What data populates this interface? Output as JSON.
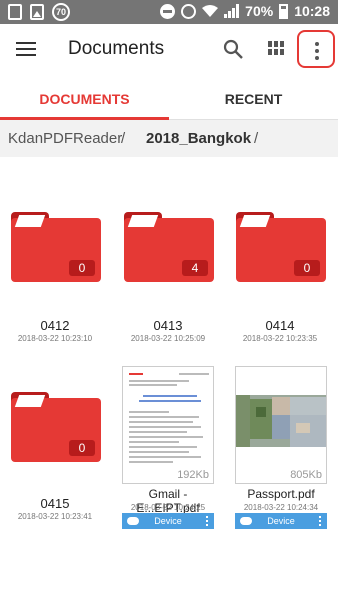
{
  "status_bar": {
    "notification_badge": "70",
    "battery_percent": "70%",
    "time": "10:28"
  },
  "app_bar": {
    "title": "Documents",
    "icons": [
      "menu-icon",
      "search-icon",
      "grid-view-icon",
      "more-options-icon"
    ]
  },
  "tabs": [
    {
      "label": "DOCUMENTS",
      "active": true
    },
    {
      "label": "RECENT",
      "active": false
    }
  ],
  "breadcrumb": {
    "root": "KdanPDFReader",
    "separator": "/",
    "current": "2018_Bangkok"
  },
  "folders": [
    {
      "name": "0412",
      "date": "2018-03-22 10:23:10",
      "count": "0"
    },
    {
      "name": "0413",
      "date": "2018-03-22 10:25:09",
      "count": "4"
    },
    {
      "name": "0414",
      "date": "2018-03-22 10:23:35",
      "count": "0"
    },
    {
      "name": "0415",
      "date": "2018-03-22 10:23:41",
      "count": "0"
    }
  ],
  "files": [
    {
      "name": "Gmail - E...EIPT.pdf",
      "date": "2018-03-22 10:24:25",
      "size": "192Kb",
      "location": "Device"
    },
    {
      "name": "Passport.pdf",
      "date": "2018-03-22 10:24:34",
      "size": "805Kb",
      "location": "Device"
    }
  ],
  "colors": {
    "accent": "#e53935",
    "folder_dark": "#b71c1c",
    "device_bar": "#4a9ee0",
    "status_bar": "#757575"
  }
}
